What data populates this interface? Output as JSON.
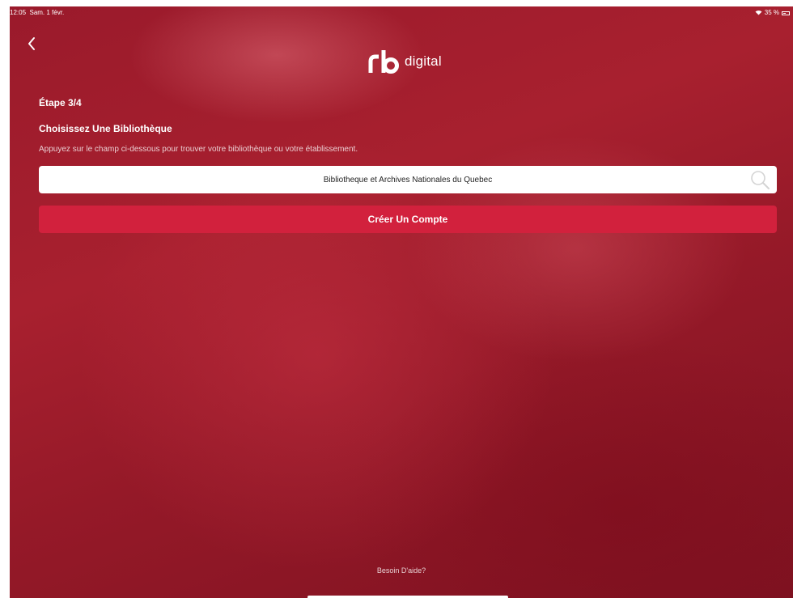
{
  "status_bar": {
    "time": "12:05",
    "date": "Sam. 1 févr.",
    "battery": "35 %",
    "wifi_icon": "wifi-icon",
    "battery_icon": "battery-icon"
  },
  "nav": {
    "back_icon": "chevron-left-icon"
  },
  "logo": {
    "text": "digital"
  },
  "form": {
    "step": "Étape 3/4",
    "heading": "Choisissez Une Bibliothèque",
    "instructions": "Appuyez sur le champ ci-dessous pour trouver votre bibliothèque ou votre établissement.",
    "library_value": "Bibliotheque et Archives Nationales du Quebec",
    "search_icon": "search-icon",
    "create_button_label": "Créer Un Compte"
  },
  "footer": {
    "help_link": "Besoin D'aide?"
  },
  "colors": {
    "background": "#9a1a2b",
    "primary_button": "#d2213d",
    "text": "#ffffff"
  }
}
